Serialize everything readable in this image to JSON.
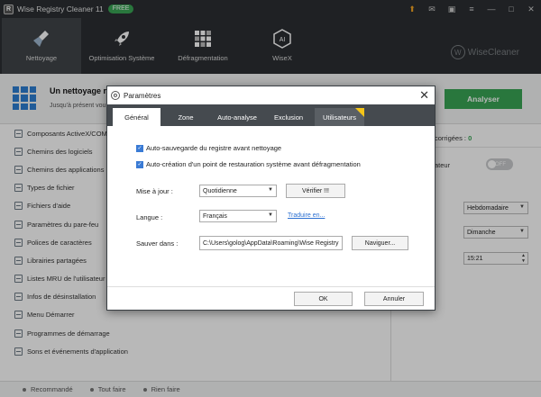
{
  "app": {
    "title": "Wise Registry Cleaner 11",
    "badge": "FREE",
    "logo_letter": "R"
  },
  "nav": {
    "tabs": [
      {
        "label": "Nettoyage",
        "icon": "broom-icon"
      },
      {
        "label": "Optimisation Système",
        "icon": "rocket-icon"
      },
      {
        "label": "Défragmentation",
        "icon": "defrag-grid-icon"
      },
      {
        "label": "WiseX",
        "icon": "wisex-ai-icon"
      }
    ],
    "brand": "WiseCleaner",
    "brand_letter": "W"
  },
  "banner": {
    "title": "Un nettoyage r",
    "subtitle": "Jusqu'à présent vou",
    "analyse_label": "Analyser"
  },
  "categories": [
    "Composants ActiveX/COM",
    "Chemins des logiciels",
    "Chemins des applications",
    "Types de fichier",
    "Fichiers d'aide",
    "Paramètres du pare-feu",
    "Polices de caractères",
    "Librairies partagées",
    "Listes MRU de l'utilisateur",
    "Infos de désinstallation",
    "Menu Démarrer",
    "Programmes de démarrage",
    "Sons et événements d'application"
  ],
  "right_panel": {
    "corrected_label": "corrigées :",
    "corrected_value": "0",
    "ateur_label": "ateur",
    "toggle_label": "OFF",
    "frequency": "Hebdomadaire",
    "day": "Dimanche",
    "time": "15:21"
  },
  "statusbar": {
    "items": [
      "Recommandé",
      "Tout faire",
      "Rien faire"
    ]
  },
  "dialog": {
    "title": "Paramètres",
    "tabs": [
      "Général",
      "Zone",
      "Auto-analyse",
      "Exclusion",
      "Utilisateurs"
    ],
    "checkbox1": "Auto-sauvegarde du registre avant nettoyage",
    "checkbox2": "Auto-création d'un point de restauration système avant défragmentation",
    "update_label": "Mise à jour :",
    "update_value": "Quotidienne",
    "verify_label": "Vérifier !!!",
    "language_label": "Langue :",
    "language_value": "Français",
    "translate_label": "Traduire en...",
    "save_label": "Sauver dans :",
    "save_path": "C:\\Users\\golog\\AppData\\Roaming\\Wise Registry",
    "browse_label": "Naviguer...",
    "ok_label": "OK",
    "cancel_label": "Annuler"
  }
}
